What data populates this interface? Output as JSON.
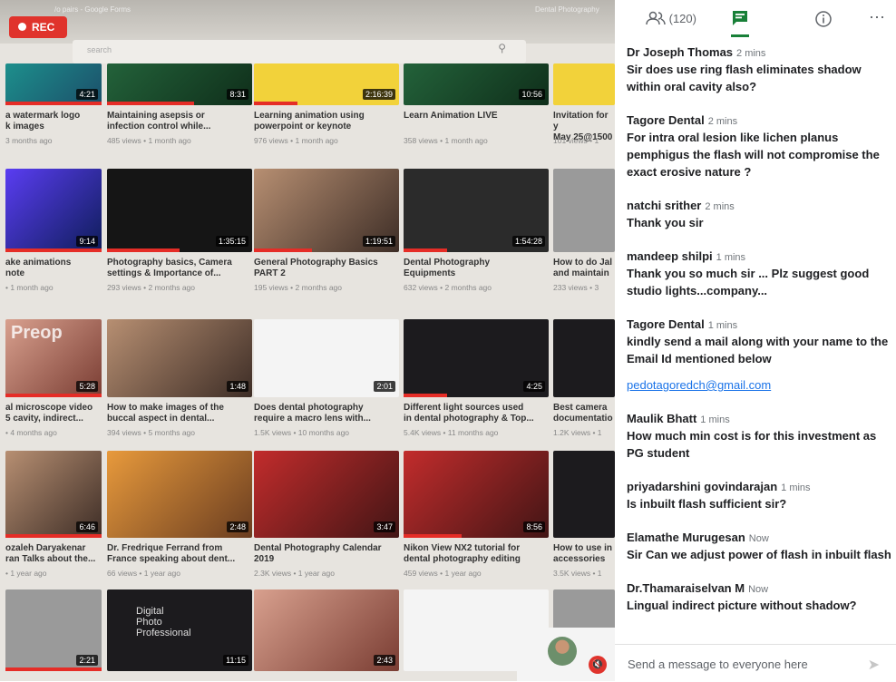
{
  "recording": {
    "label": "REC"
  },
  "shared_screen": {
    "topbar_left": "/o pairs - Google Forms",
    "topbar_right": "Dental Photography",
    "search_placeholder": "search",
    "videos": [
      {
        "title": "a watermark logo\nk images",
        "meta": "3 months ago",
        "duration": "4:21",
        "progress": 1
      },
      {
        "title": "Maintaining asepsis or\ninfection control while...",
        "meta": "485 views • 1 month ago",
        "duration": "8:31",
        "progress": 0.6
      },
      {
        "title": "Learning animation using\npowerpoint or keynote",
        "meta": "976 views • 1 month ago",
        "duration": "2:16:39",
        "progress": 0.3
      },
      {
        "title": "Learn Animation LIVE",
        "meta": "358 views • 1 month ago",
        "duration": "10:56",
        "progress": 0
      },
      {
        "title": "Invitation for y\nMay 25@1500",
        "meta": "101 views • 1",
        "duration": "",
        "progress": 0
      },
      {
        "title": "ake animations\nnote",
        "meta": "• 1 month ago",
        "duration": "9:14",
        "progress": 1
      },
      {
        "title": "Photography basics, Camera\nsettings & Importance of...",
        "meta": "293 views • 2 months ago",
        "duration": "1:35:15",
        "progress": 0.5
      },
      {
        "title": "General Photography Basics\nPART 2",
        "meta": "195 views • 2 months ago",
        "duration": "1:19:51",
        "progress": 0.4
      },
      {
        "title": "Dental Photography\nEquipments",
        "meta": "632 views • 2 months ago",
        "duration": "1:54:28",
        "progress": 0.3
      },
      {
        "title": "How to do Jal\nand maintain",
        "meta": "233 views • 3",
        "duration": "",
        "progress": 0
      },
      {
        "title": "al microscope video\n5 cavity, indirect...",
        "meta": "• 4 months ago",
        "duration": "5:28",
        "progress": 1
      },
      {
        "title": "How to make images of the\nbuccal aspect in dental...",
        "meta": "394 views • 5 months ago",
        "duration": "1:48",
        "progress": 0
      },
      {
        "title": "Does dental photography\nrequire a macro lens with...",
        "meta": "1.5K views • 10 months ago",
        "duration": "2:01",
        "progress": 0
      },
      {
        "title": "Different light sources used\nin dental photography & Top...",
        "meta": "5.4K views • 11 months ago",
        "duration": "4:25",
        "progress": 0.3
      },
      {
        "title": "Best camera\ndocumentatio",
        "meta": "1.2K views • 1",
        "duration": "",
        "progress": 0
      },
      {
        "title": "ozaleh Daryakenar\nran Talks about the...",
        "meta": "• 1 year ago",
        "duration": "6:46",
        "progress": 1
      },
      {
        "title": "Dr. Fredrique Ferrand from\nFrance speaking about dent...",
        "meta": "66 views • 1 year ago",
        "duration": "2:48",
        "progress": 0
      },
      {
        "title": "Dental Photography Calendar\n2019",
        "meta": "2.3K views • 1 year ago",
        "duration": "3:47",
        "progress": 0
      },
      {
        "title": "Nikon View NX2 tutorial for\ndental photography editing",
        "meta": "459 views • 1 year ago",
        "duration": "8:56",
        "progress": 0.4
      },
      {
        "title": "How to use in\naccessories",
        "meta": "3.5K views • 1",
        "duration": "",
        "progress": 0
      },
      {
        "title": "",
        "meta": "",
        "duration": "2:21",
        "progress": 1
      },
      {
        "title": "",
        "meta": "",
        "duration": "11:15",
        "progress": 0
      },
      {
        "title": "",
        "meta": "",
        "duration": "2:43",
        "progress": 0
      },
      {
        "title": "",
        "meta": "",
        "duration": "",
        "progress": 0
      },
      {
        "title": "",
        "meta": "",
        "duration": "",
        "progress": 0
      }
    ],
    "thumb_overlays": {
      "preop": "Preop",
      "digital_photo": "Digital\nPhoto\nProfessional"
    }
  },
  "chat": {
    "participants_count": "(120)",
    "messages": [
      {
        "sender": "Dr Joseph Thomas",
        "time": "2 mins",
        "lines": [
          "Sir does use ring flash eliminates shadow within oral cavity also?"
        ]
      },
      {
        "sender": "Tagore Dental",
        "time": "2 mins",
        "lines": [
          "For intra oral lesion like lichen planus pemphigus the flash will not compromise the exact erosive nature ?"
        ]
      },
      {
        "sender": "natchi srither",
        "time": "2 mins",
        "lines": [
          "Thank you sir"
        ]
      },
      {
        "sender": "mandeep shilpi",
        "time": "1 mins",
        "lines": [
          "Thank you so much sir ... Plz suggest good studio lights...company..."
        ]
      },
      {
        "sender": "Tagore Dental",
        "time": "1 mins",
        "lines": [
          "kindly send a mail along with your name to the Email Id mentioned below"
        ],
        "link": "pedotagoredch@gmail.com"
      },
      {
        "sender": "Maulik Bhatt",
        "time": "1 mins",
        "lines": [
          "How much min cost is for this investment as PG student"
        ]
      },
      {
        "sender": "priyadarshini govindarajan",
        "time": "1 mins",
        "lines": [
          "Is inbuilt flash sufficient sir?"
        ]
      },
      {
        "sender": "Elamathe Murugesan",
        "time": "Now",
        "lines": [
          "Sir Can we adjust power of flash in inbuilt flash"
        ]
      },
      {
        "sender": "Dr.Thamaraiselvan M",
        "time": "Now",
        "lines": [
          "Lingual indirect picture without shadow?"
        ]
      }
    ],
    "compose_placeholder": "Send a message to everyone here"
  },
  "icons": [
    "people-icon",
    "chat-icon",
    "info-icon",
    "more-options-icon",
    "send-icon",
    "mic-off-icon"
  ],
  "colors": {
    "rec": "#e0332c",
    "chat_active": "#188038",
    "link": "#1a73e8"
  }
}
